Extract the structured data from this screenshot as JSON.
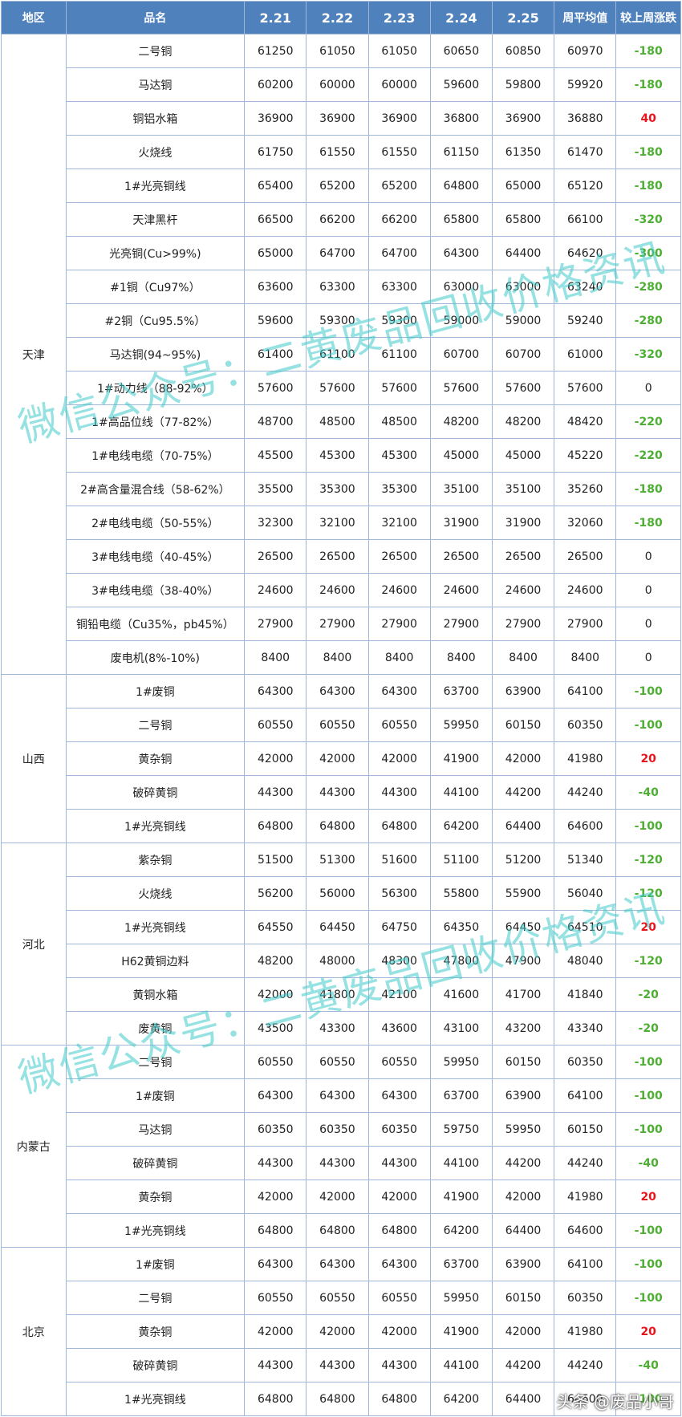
{
  "header": {
    "region": "地区",
    "name": "品名",
    "dates": [
      "2.21",
      "2.22",
      "2.23",
      "2.24",
      "2.25"
    ],
    "avg": "周平均值",
    "change": "较上周涨跌"
  },
  "groups": [
    {
      "region": "天津",
      "rows": [
        {
          "name": "二号铜",
          "values": [
            "61250",
            "61050",
            "61050",
            "60650",
            "60850"
          ],
          "avg": "60970",
          "change": "-180"
        },
        {
          "name": "马达铜",
          "values": [
            "60200",
            "60000",
            "60000",
            "59600",
            "59800"
          ],
          "avg": "59920",
          "change": "-180"
        },
        {
          "name": "铜铝水箱",
          "values": [
            "36900",
            "36900",
            "36900",
            "36800",
            "36900"
          ],
          "avg": "36880",
          "change": "40"
        },
        {
          "name": "火烧线",
          "values": [
            "61750",
            "61550",
            "61550",
            "61150",
            "61350"
          ],
          "avg": "61470",
          "change": "-180"
        },
        {
          "name": "1#光亮铜线",
          "values": [
            "65400",
            "65200",
            "65200",
            "64800",
            "65000"
          ],
          "avg": "65120",
          "change": "-180"
        },
        {
          "name": "天津黑杆",
          "values": [
            "66500",
            "66200",
            "66200",
            "65800",
            "65800"
          ],
          "avg": "66100",
          "change": "-320"
        },
        {
          "name": "光亮铜(Cu>99%)",
          "values": [
            "65000",
            "64700",
            "64700",
            "64300",
            "64400"
          ],
          "avg": "64620",
          "change": "-300"
        },
        {
          "name": "#1铜（Cu97%）",
          "values": [
            "63600",
            "63300",
            "63300",
            "63000",
            "63000"
          ],
          "avg": "63240",
          "change": "-280"
        },
        {
          "name": "#2铜（Cu95.5%）",
          "values": [
            "59600",
            "59300",
            "59300",
            "59000",
            "59000"
          ],
          "avg": "59240",
          "change": "-280"
        },
        {
          "name": "马达铜(94~95%)",
          "values": [
            "61400",
            "61100",
            "61100",
            "60700",
            "60700"
          ],
          "avg": "61000",
          "change": "-320"
        },
        {
          "name": "1#动力线（88-92%）",
          "values": [
            "57600",
            "57600",
            "57600",
            "57600",
            "57600"
          ],
          "avg": "57600",
          "change": "0"
        },
        {
          "name": "1#高品位线（77-82%）",
          "values": [
            "48700",
            "48500",
            "48500",
            "48200",
            "48200"
          ],
          "avg": "48420",
          "change": "-220"
        },
        {
          "name": "1#电线电缆（70-75%）",
          "values": [
            "45500",
            "45300",
            "45300",
            "45000",
            "45000"
          ],
          "avg": "45220",
          "change": "-220"
        },
        {
          "name": "2#高含量混合线（58-62%）",
          "values": [
            "35500",
            "35300",
            "35300",
            "35100",
            "35100"
          ],
          "avg": "35260",
          "change": "-180"
        },
        {
          "name": "2#电线电缆（50-55%）",
          "values": [
            "32300",
            "32100",
            "32100",
            "31900",
            "31900"
          ],
          "avg": "32060",
          "change": "-180"
        },
        {
          "name": "3#电线电缆（40-45%）",
          "values": [
            "26500",
            "26500",
            "26500",
            "26500",
            "26500"
          ],
          "avg": "26500",
          "change": "0"
        },
        {
          "name": "3#电线电缆（38-40%）",
          "values": [
            "24600",
            "24600",
            "24600",
            "24600",
            "24600"
          ],
          "avg": "24600",
          "change": "0"
        },
        {
          "name": "铜铅电缆（Cu35%，pb45%）",
          "values": [
            "27900",
            "27900",
            "27900",
            "27900",
            "27900"
          ],
          "avg": "27900",
          "change": "0"
        },
        {
          "name": "废电机(8%-10%)",
          "values": [
            "8400",
            "8400",
            "8400",
            "8400",
            "8400"
          ],
          "avg": "8400",
          "change": "0"
        }
      ]
    },
    {
      "region": "山西",
      "rows": [
        {
          "name": "1#废铜",
          "values": [
            "64300",
            "64300",
            "64300",
            "63700",
            "63900"
          ],
          "avg": "64100",
          "change": "-100"
        },
        {
          "name": "二号铜",
          "values": [
            "60550",
            "60550",
            "60550",
            "59950",
            "60150"
          ],
          "avg": "60350",
          "change": "-100"
        },
        {
          "name": "黄杂铜",
          "values": [
            "42000",
            "42000",
            "42000",
            "41900",
            "42000"
          ],
          "avg": "41980",
          "change": "20"
        },
        {
          "name": "破碎黄铜",
          "values": [
            "44300",
            "44300",
            "44300",
            "44100",
            "44200"
          ],
          "avg": "44240",
          "change": "-40"
        },
        {
          "name": "1#光亮铜线",
          "values": [
            "64800",
            "64800",
            "64800",
            "64200",
            "64400"
          ],
          "avg": "64600",
          "change": "-100"
        }
      ]
    },
    {
      "region": "河北",
      "rows": [
        {
          "name": "紫杂铜",
          "values": [
            "51500",
            "51300",
            "51600",
            "51100",
            "51200"
          ],
          "avg": "51340",
          "change": "-120"
        },
        {
          "name": "火烧线",
          "values": [
            "56200",
            "56000",
            "56300",
            "55800",
            "55900"
          ],
          "avg": "56040",
          "change": "-120"
        },
        {
          "name": "1#光亮铜线",
          "values": [
            "64550",
            "64450",
            "64750",
            "64350",
            "64450"
          ],
          "avg": "64510",
          "change": "20"
        },
        {
          "name": "H62黄铜边料",
          "values": [
            "48200",
            "48000",
            "48300",
            "47800",
            "47900"
          ],
          "avg": "48040",
          "change": "-120"
        },
        {
          "name": "黄铜水箱",
          "values": [
            "42000",
            "41800",
            "42100",
            "41600",
            "41700"
          ],
          "avg": "41840",
          "change": "-20"
        },
        {
          "name": "废黄铜",
          "values": [
            "43500",
            "43300",
            "43600",
            "43100",
            "43200"
          ],
          "avg": "43340",
          "change": "-20"
        }
      ]
    },
    {
      "region": "内蒙古",
      "rows": [
        {
          "name": "二号铜",
          "values": [
            "60550",
            "60550",
            "60550",
            "59950",
            "60150"
          ],
          "avg": "60350",
          "change": "-100"
        },
        {
          "name": "1#废铜",
          "values": [
            "64300",
            "64300",
            "64300",
            "63700",
            "63900"
          ],
          "avg": "64100",
          "change": "-100"
        },
        {
          "name": "马达铜",
          "values": [
            "60350",
            "60350",
            "60350",
            "59750",
            "59950"
          ],
          "avg": "60150",
          "change": "-100"
        },
        {
          "name": "破碎黄铜",
          "values": [
            "44300",
            "44300",
            "44300",
            "44100",
            "44200"
          ],
          "avg": "44240",
          "change": "-40"
        },
        {
          "name": "黄杂铜",
          "values": [
            "42000",
            "42000",
            "42000",
            "41900",
            "42000"
          ],
          "avg": "41980",
          "change": "20"
        },
        {
          "name": "1#光亮铜线",
          "values": [
            "64800",
            "64800",
            "64800",
            "64200",
            "64400"
          ],
          "avg": "64600",
          "change": "-100"
        }
      ]
    },
    {
      "region": "北京",
      "rows": [
        {
          "name": "1#废铜",
          "values": [
            "64300",
            "64300",
            "64300",
            "63700",
            "63900"
          ],
          "avg": "64100",
          "change": "-100"
        },
        {
          "name": "二号铜",
          "values": [
            "60550",
            "60550",
            "60550",
            "59950",
            "60150"
          ],
          "avg": "60350",
          "change": "-100"
        },
        {
          "name": "黄杂铜",
          "values": [
            "42000",
            "42000",
            "42000",
            "41900",
            "42000"
          ],
          "avg": "41980",
          "change": "20"
        },
        {
          "name": "破碎黄铜",
          "values": [
            "44300",
            "44300",
            "44300",
            "44100",
            "44200"
          ],
          "avg": "44240",
          "change": "-40"
        },
        {
          "name": "1#光亮铜线",
          "values": [
            "64800",
            "64800",
            "64800",
            "64200",
            "64400"
          ],
          "avg": "64600",
          "change": "-100"
        }
      ]
    }
  ],
  "watermark": "微信公众号：二黄废品回收价格资讯",
  "signature": "头条 @废品小哥",
  "colors": {
    "header_bg": "#4f81bd",
    "down": "#4caf32",
    "up": "#e8141c",
    "watermark": "#40c8c8"
  }
}
